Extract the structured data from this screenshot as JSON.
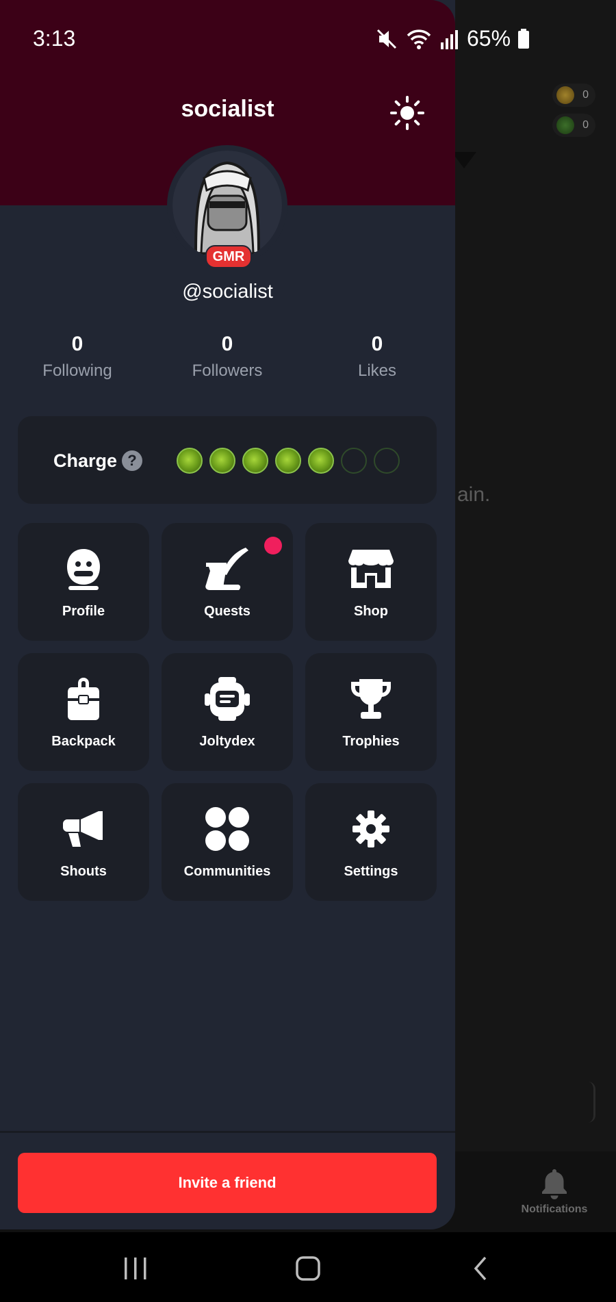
{
  "status_bar": {
    "time": "3:13",
    "battery_percent": "65%"
  },
  "background_app": {
    "coins": "0",
    "bills": "0",
    "partial_text": "ain.",
    "notifications_label": "Notifications"
  },
  "drawer": {
    "username": "socialist",
    "handle": "@socialist",
    "badge": "GMR",
    "stats": {
      "following": {
        "count": "0",
        "label": "Following"
      },
      "followers": {
        "count": "0",
        "label": "Followers"
      },
      "likes": {
        "count": "0",
        "label": "Likes"
      }
    },
    "charge": {
      "label": "Charge",
      "help_glyph": "?",
      "filled": 5,
      "total": 7
    },
    "menu": {
      "profile": "Profile",
      "quests": "Quests",
      "shop": "Shop",
      "backpack": "Backpack",
      "joltydex": "Joltydex",
      "trophies": "Trophies",
      "shouts": "Shouts",
      "communities": "Communities",
      "settings": "Settings"
    },
    "invite_label": "Invite a friend"
  },
  "colors": {
    "header": "#3c0117",
    "drawer_bg": "#212633",
    "tile_bg": "#1c1f27",
    "accent_red": "#ff3131",
    "notification_dot": "#f01f5d",
    "charge_green": "#8bc34a"
  }
}
